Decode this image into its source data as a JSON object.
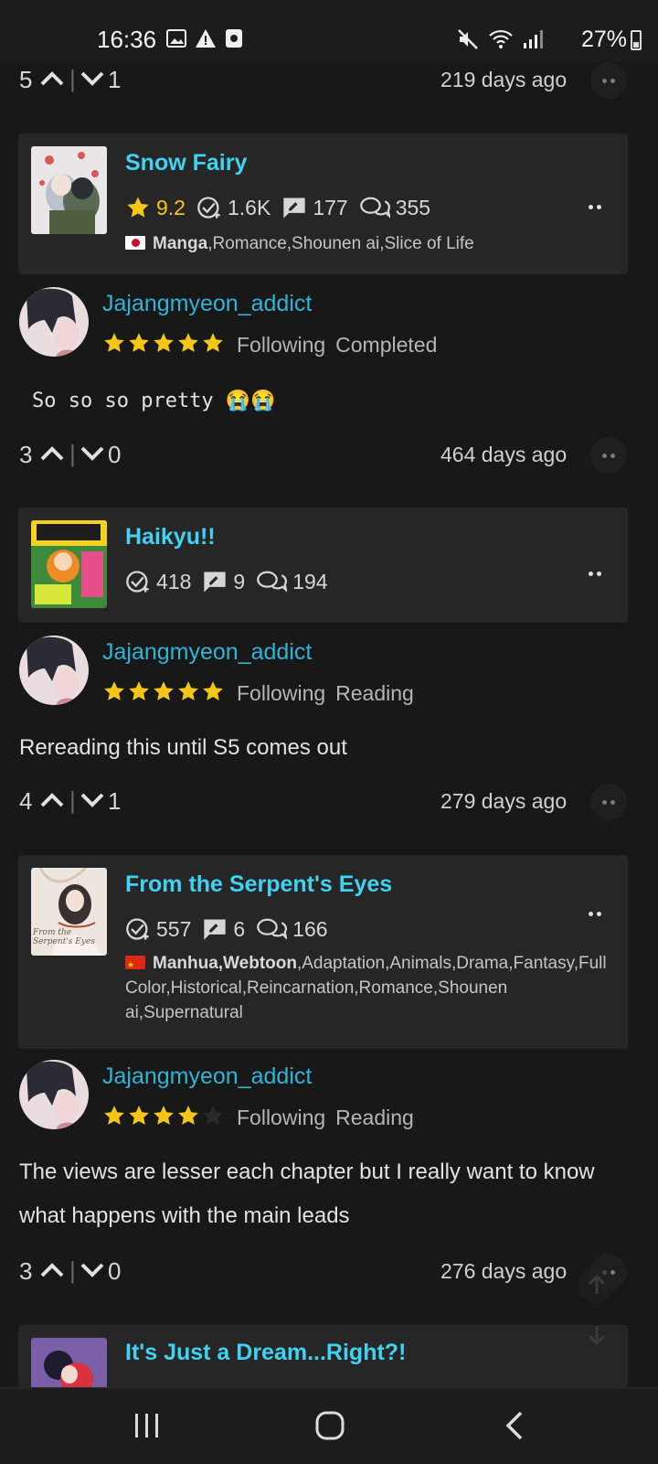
{
  "status_bar": {
    "time": "16:36",
    "battery": "27%"
  },
  "colors": {
    "accent": "#3fd2f2",
    "username": "#2fb4d6",
    "star": "#f5c518",
    "background": "#181818",
    "card": "#262626"
  },
  "top_vote_row": {
    "up": "5",
    "down": "1",
    "ago": "219 days ago"
  },
  "entries": [
    {
      "series": {
        "title": "Snow Fairy",
        "rating": "9.2",
        "follows": "1.6K",
        "reviews": "177",
        "comments": "355",
        "flag": "jp",
        "tags_bold": "Manga",
        "tags_rest": ",Romance,Shounen ai,Slice of Life"
      },
      "review": {
        "user": "Jajangmyeon_addict",
        "stars": 5,
        "follow_status": "Following",
        "read_status": "Completed",
        "text": "So so so pretty 😭😭",
        "up": "3",
        "down": "0",
        "ago": "464 days ago"
      }
    },
    {
      "series": {
        "title": "Haikyu!!",
        "follows": "418",
        "reviews": "9",
        "comments": "194"
      },
      "review": {
        "user": "Jajangmyeon_addict",
        "stars": 5,
        "follow_status": "Following",
        "read_status": "Reading",
        "text": "Rereading this until S5 comes out",
        "up": "4",
        "down": "1",
        "ago": "279 days ago"
      }
    },
    {
      "series": {
        "title": "From the Serpent's Eyes",
        "follows": "557",
        "reviews": "6",
        "comments": "166",
        "flag": "cn",
        "tags_bold": "Manhua,Webtoon",
        "tags_rest": ",Adaptation,Animals,Drama,Fantasy,Full Color,Historical,Reincarnation,Romance,Shounen ai,Supernatural",
        "cover_text": "From the Serpent's Eyes"
      },
      "review": {
        "user": "Jajangmyeon_addict",
        "stars": 4,
        "follow_status": "Following",
        "read_status": "Reading",
        "text": "The views are lesser each chapter but I really want to know what happens with the main leads",
        "up": "3",
        "down": "0",
        "ago": "276 days ago"
      }
    },
    {
      "series": {
        "title": "It's Just a Dream...Right?!"
      }
    }
  ]
}
